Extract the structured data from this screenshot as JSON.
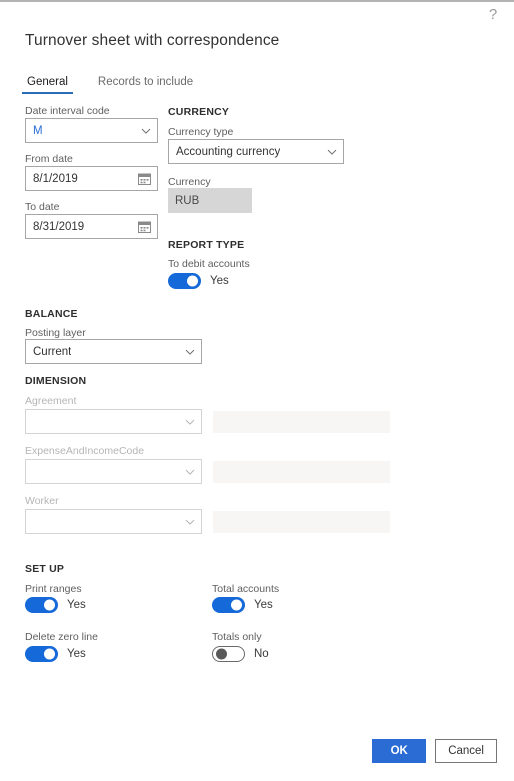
{
  "window": {
    "help_icon": "?",
    "title": "Turnover sheet with correspondence"
  },
  "tabs": [
    {
      "label": "General",
      "active": true
    },
    {
      "label": "Records to include",
      "active": false
    }
  ],
  "general": {
    "date_interval": {
      "label": "Date interval code",
      "value": "M",
      "icon": "chevron-down-icon"
    },
    "from_date": {
      "label": "From date",
      "value": "8/1/2019",
      "icon": "calendar-icon"
    },
    "to_date": {
      "label": "To date",
      "value": "8/31/2019",
      "icon": "calendar-icon"
    },
    "currency_section": {
      "heading": "CURRENCY",
      "currency_type": {
        "label": "Currency type",
        "value": "Accounting currency",
        "icon": "chevron-down-icon"
      },
      "currency": {
        "label": "Currency",
        "value": "RUB"
      }
    },
    "report_type_section": {
      "heading": "REPORT TYPE",
      "to_debit_accounts": {
        "label": "To debit accounts",
        "state": "Yes",
        "on": true
      }
    },
    "balance_section": {
      "heading": "BALANCE",
      "posting_layer": {
        "label": "Posting layer",
        "value": "Current",
        "icon": "chevron-down-icon"
      }
    },
    "dimension_section": {
      "heading": "DIMENSION",
      "rows": [
        {
          "label": "Agreement",
          "value": "",
          "secondary_value": "",
          "icon": "chevron-down-icon"
        },
        {
          "label": "ExpenseAndIncomeCode",
          "value": "",
          "secondary_value": "",
          "icon": "chevron-down-icon"
        },
        {
          "label": "Worker",
          "value": "",
          "secondary_value": "",
          "icon": "chevron-down-icon"
        }
      ]
    },
    "setup_section": {
      "heading": "SET UP",
      "toggles": [
        {
          "label": "Print ranges",
          "state": "Yes",
          "on": true
        },
        {
          "label": "Total accounts",
          "state": "Yes",
          "on": true
        },
        {
          "label": "Delete zero line",
          "state": "Yes",
          "on": true
        },
        {
          "label": "Totals only",
          "state": "No",
          "on": false
        }
      ]
    }
  },
  "footer": {
    "ok_label": "OK",
    "cancel_label": "Cancel"
  },
  "colors": {
    "accent": "#2b6cd4",
    "toggle_on": "#1569d8",
    "tab_underline": "#2b6cb8",
    "readonly_bg": "#d6d6d6",
    "ghost_bg": "#f7f6f5",
    "value_blue": "#2a6fd1"
  }
}
